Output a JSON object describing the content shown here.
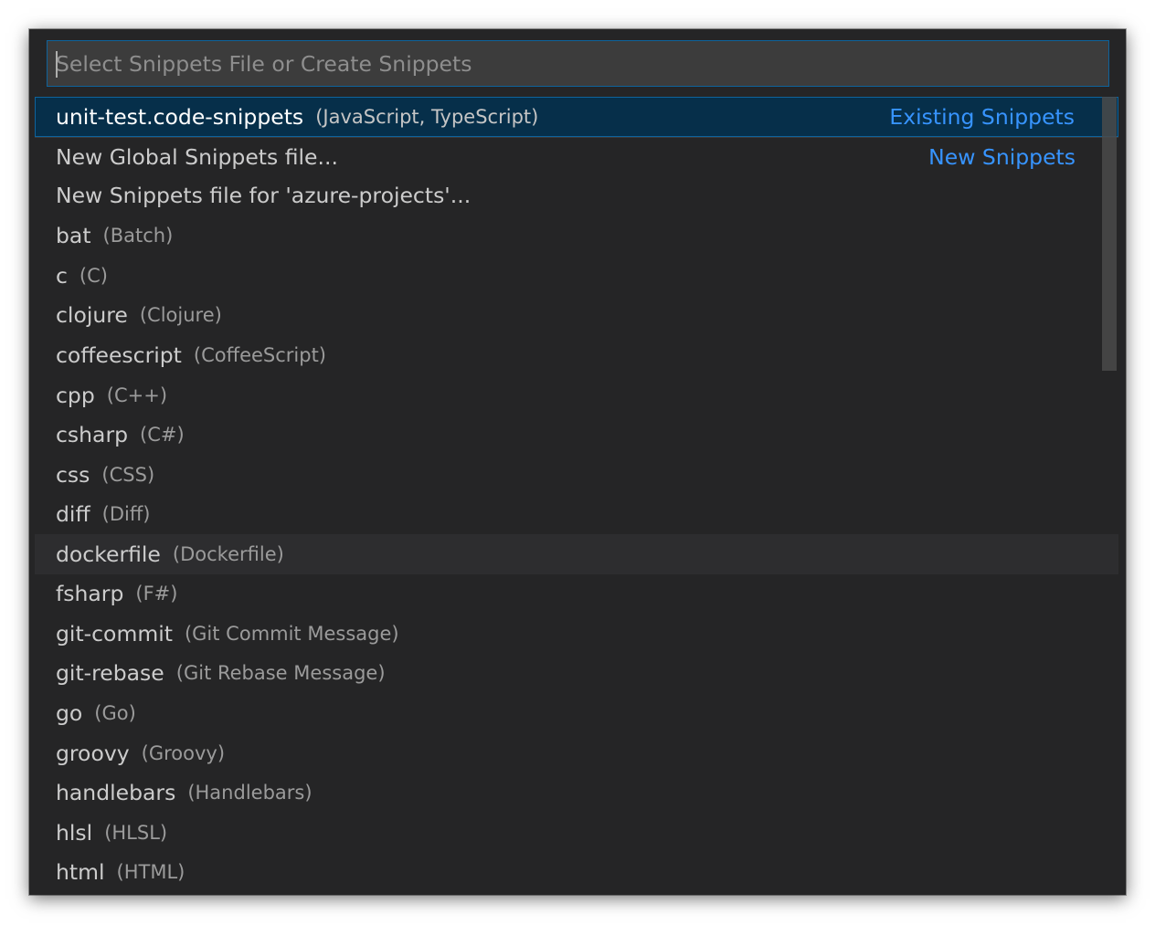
{
  "search": {
    "placeholder": "Select Snippets File or Create Snippets",
    "value": ""
  },
  "items": [
    {
      "label": "unit-test.code-snippets",
      "description": "(JavaScript, TypeScript)",
      "group": "Existing Snippets"
    },
    {
      "label": "New Global Snippets file...",
      "description": "",
      "group": "New Snippets"
    },
    {
      "label": "New Snippets file for 'azure-projects'...",
      "description": "",
      "group": ""
    },
    {
      "label": "bat",
      "description": "(Batch)",
      "group": ""
    },
    {
      "label": "c",
      "description": "(C)",
      "group": ""
    },
    {
      "label": "clojure",
      "description": "(Clojure)",
      "group": ""
    },
    {
      "label": "coffeescript",
      "description": "(CoffeeScript)",
      "group": ""
    },
    {
      "label": "cpp",
      "description": "(C++)",
      "group": ""
    },
    {
      "label": "csharp",
      "description": "(C#)",
      "group": ""
    },
    {
      "label": "css",
      "description": "(CSS)",
      "group": ""
    },
    {
      "label": "diff",
      "description": "(Diff)",
      "group": ""
    },
    {
      "label": "dockerfile",
      "description": "(Dockerfile)",
      "group": ""
    },
    {
      "label": "fsharp",
      "description": "(F#)",
      "group": ""
    },
    {
      "label": "git-commit",
      "description": "(Git Commit Message)",
      "group": ""
    },
    {
      "label": "git-rebase",
      "description": "(Git Rebase Message)",
      "group": ""
    },
    {
      "label": "go",
      "description": "(Go)",
      "group": ""
    },
    {
      "label": "groovy",
      "description": "(Groovy)",
      "group": ""
    },
    {
      "label": "handlebars",
      "description": "(Handlebars)",
      "group": ""
    },
    {
      "label": "hlsl",
      "description": "(HLSL)",
      "group": ""
    },
    {
      "label": "html",
      "description": "(HTML)",
      "group": ""
    }
  ],
  "state": {
    "selected_item": "unit-test.code-snippets",
    "hovered_item": "dockerfile"
  },
  "colors": {
    "background": "#252526",
    "input_background": "#3c3c3c",
    "focus_border": "#0e639c",
    "selection_background": "#062f4a",
    "group_label": "#3794ff"
  }
}
